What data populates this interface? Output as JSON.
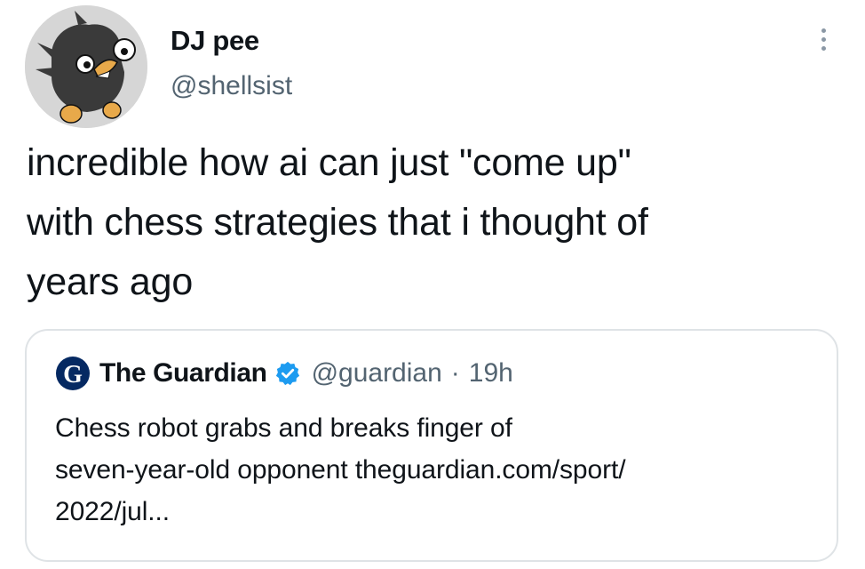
{
  "tweet": {
    "author": {
      "display_name": "DJ pee",
      "handle": "@shellsist",
      "avatar_icon": "cartoon-bird-avatar"
    },
    "more_icon": "more-options-icon",
    "text_lines": [
      "incredible how ai can just \"come up\"",
      "with chess strategies that i thought of",
      "years ago"
    ],
    "quote": {
      "logo_icon": "guardian-logo-icon",
      "name": "The Guardian",
      "verified_icon": "verified-badge-icon",
      "handle": "@guardian",
      "separator": "·",
      "time": "19h",
      "text_lines": [
        "Chess robot grabs and breaks finger of",
        "seven-year-old opponent theguardian.com/sport/",
        "2022/jul..."
      ]
    }
  },
  "colors": {
    "text": "#0f1419",
    "secondary_text": "#536471",
    "verified": "#1d9bf0",
    "guardian_blue": "#052962",
    "card_border": "#dfe3e6"
  }
}
